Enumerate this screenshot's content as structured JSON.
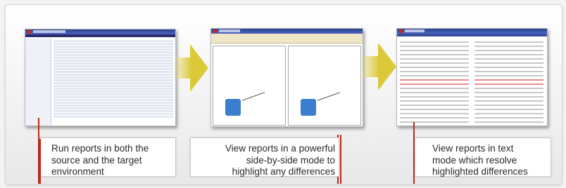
{
  "steps": [
    {
      "caption_lines": [
        "Run reports in both the",
        "source and the target",
        "environment"
      ]
    },
    {
      "caption_lines": [
        "View  reports in a powerful",
        "side-by-side mode to",
        "highlight any differences"
      ]
    },
    {
      "caption_lines": [
        "View  reports in text",
        "mode which resolve",
        "highlighted differences"
      ]
    }
  ],
  "colors": {
    "accent_red": "#c0281d",
    "arrow_yellow": "#dcc93a",
    "title_blue": "#2b3f8a"
  }
}
